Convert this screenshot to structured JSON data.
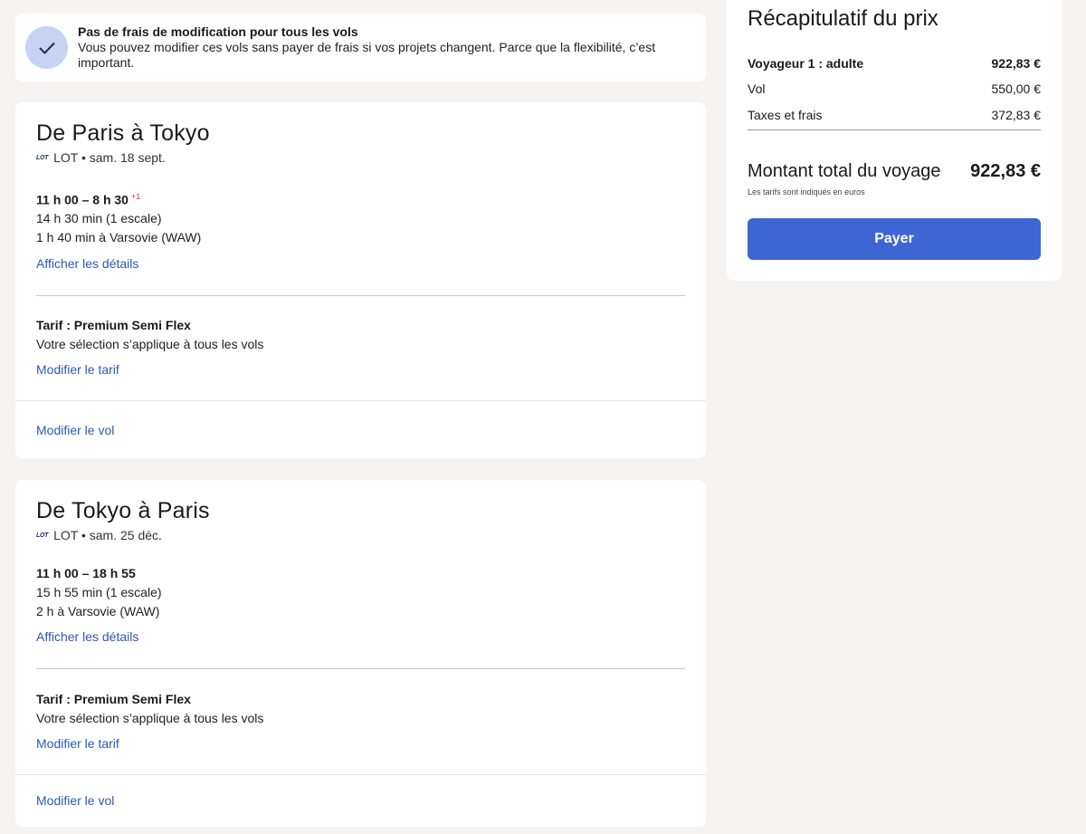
{
  "notice": {
    "title": "Pas de frais de modification pour tous les vols",
    "description": "Vous pouvez modifier ces vols sans payer de frais si vos projets changent. Parce que la flexibilité, c’est important.",
    "icon": "check-icon"
  },
  "flights": [
    {
      "title": "De Paris à Tokyo",
      "airline_logo": "LOT",
      "airline_line": "LOT • sam. 18 sept.",
      "times": "11 h 00 – 8 h 30",
      "day_offset": "+1",
      "duration": "14 h 30 min (1 escale)",
      "stopover": "1 h 40 min à Varsovie (WAW)",
      "details_link": "Afficher les détails",
      "fare_title": "Tarif : Premium Semi Flex",
      "fare_note": "Votre sélection s’applique à tous les vols",
      "change_fare_link": "Modifier le tarif",
      "change_flight_link": "Modifier le vol"
    },
    {
      "title": "De Tokyo à Paris",
      "airline_logo": "LOT",
      "airline_line": "LOT • sam. 25 déc.",
      "times": "11 h 00 – 18 h 55",
      "day_offset": "",
      "duration": "15 h 55 min (1 escale)",
      "stopover": "2 h à Varsovie (WAW)",
      "details_link": "Afficher les détails",
      "fare_title": "Tarif : Premium Semi Flex",
      "fare_note": "Votre sélection s’applique à tous les vols",
      "change_fare_link": "Modifier le tarif",
      "change_flight_link": "Modifier le vol"
    }
  ],
  "summary": {
    "title": "Récapitulatif du prix",
    "traveler_label": "Voyageur 1 : adulte",
    "traveler_value": "922,83 €",
    "flight_label": "Vol",
    "flight_value": "550,00 €",
    "taxes_label": "Taxes et frais",
    "taxes_value": "372,83 €",
    "total_label": "Montant total du voyage",
    "total_value": "922,83 €",
    "total_note": "Les tarifs sont indiqués en euros",
    "pay_label": "Payer"
  },
  "colors": {
    "accent": "#3d66d4",
    "link": "#2c58b4",
    "background": "#f7f3f1",
    "check_circle": "#c7d3f4",
    "day_offset": "#d93030"
  }
}
